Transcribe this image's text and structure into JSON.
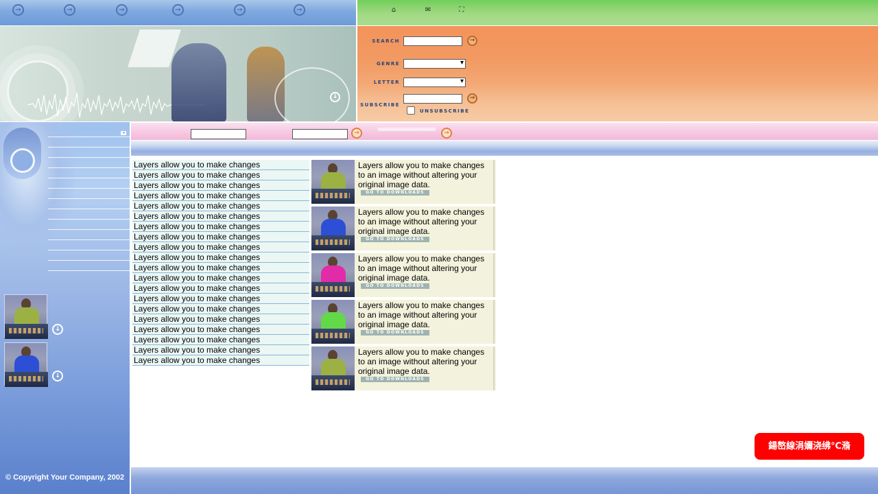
{
  "top_nav": {
    "arrow_count": 6,
    "icons": [
      "home-icon",
      "mail-icon",
      "sitemap-icon"
    ],
    "colors": {
      "left": "#7fa8de",
      "right": "#8ad36e"
    }
  },
  "search_panel": {
    "search_label": "SEARCH",
    "genre_label": "GENRE",
    "letter_label": "LETTER",
    "subscribe_label": "SUBSCRIBE",
    "unsubscribe_label": "UNSUBSCRIBE",
    "search_value": "",
    "subscribe_value": "",
    "genre_selected": "",
    "letter_selected": "",
    "colors": {
      "panel": "#f29a63"
    }
  },
  "pink_bar": {
    "input1_value": "",
    "input2_value": ""
  },
  "link_list": [
    "Layers allow you to make changes",
    "Layers allow you to make changes",
    "Layers allow you to make changes",
    "Layers allow you to make changes",
    "Layers allow you to make changes",
    "Layers allow you to make changes",
    "Layers allow you to make changes",
    "Layers allow you to make changes",
    "Layers allow you to make changes",
    "Layers allow you to make changes",
    "Layers allow you to make changes",
    "Layers allow you to make changes",
    "Layers allow you to make changes",
    "Layers allow you to make changes",
    "Layers allow you to make changes",
    "Layers allow you to make changes",
    "Layers allow you to make changes",
    "Layers allow you to make changes",
    "Layers allow you to make changes",
    "Layers allow you to make changes"
  ],
  "cards": [
    {
      "text": "Layers allow you to make changes to an image without altering your original image data.",
      "button": "GO TO DOWNLOADS",
      "shirt_color": "#9bb144"
    },
    {
      "text": "Layers allow you to make changes to an image without altering your original image data.",
      "button": "GO TO DOWNLOADS",
      "shirt_color": "#2d4fd6"
    },
    {
      "text": "Layers allow you to make changes to an image without altering your original image data.",
      "button": "GO TO DOWNLOADS",
      "shirt_color": "#e22ba8"
    },
    {
      "text": "Layers allow you to make changes to an image without altering your original image data.",
      "button": "GO TO DOWNLOADS",
      "shirt_color": "#62d948"
    },
    {
      "text": "Layers allow you to make changes to an image without altering your original image data.",
      "button": "GO TO DOWNLOADS",
      "shirt_color": "#9bb144"
    }
  ],
  "sidebar": {
    "thumbs": [
      {
        "shirt_color": "#9bb144"
      },
      {
        "shirt_color": "#2d4fd6"
      }
    ],
    "copyright": "© Copyright Your Company, 2002"
  },
  "badge": {
    "text": "鍚嶅線涓嬭浇绋℃潃",
    "color": "#ff0000"
  }
}
